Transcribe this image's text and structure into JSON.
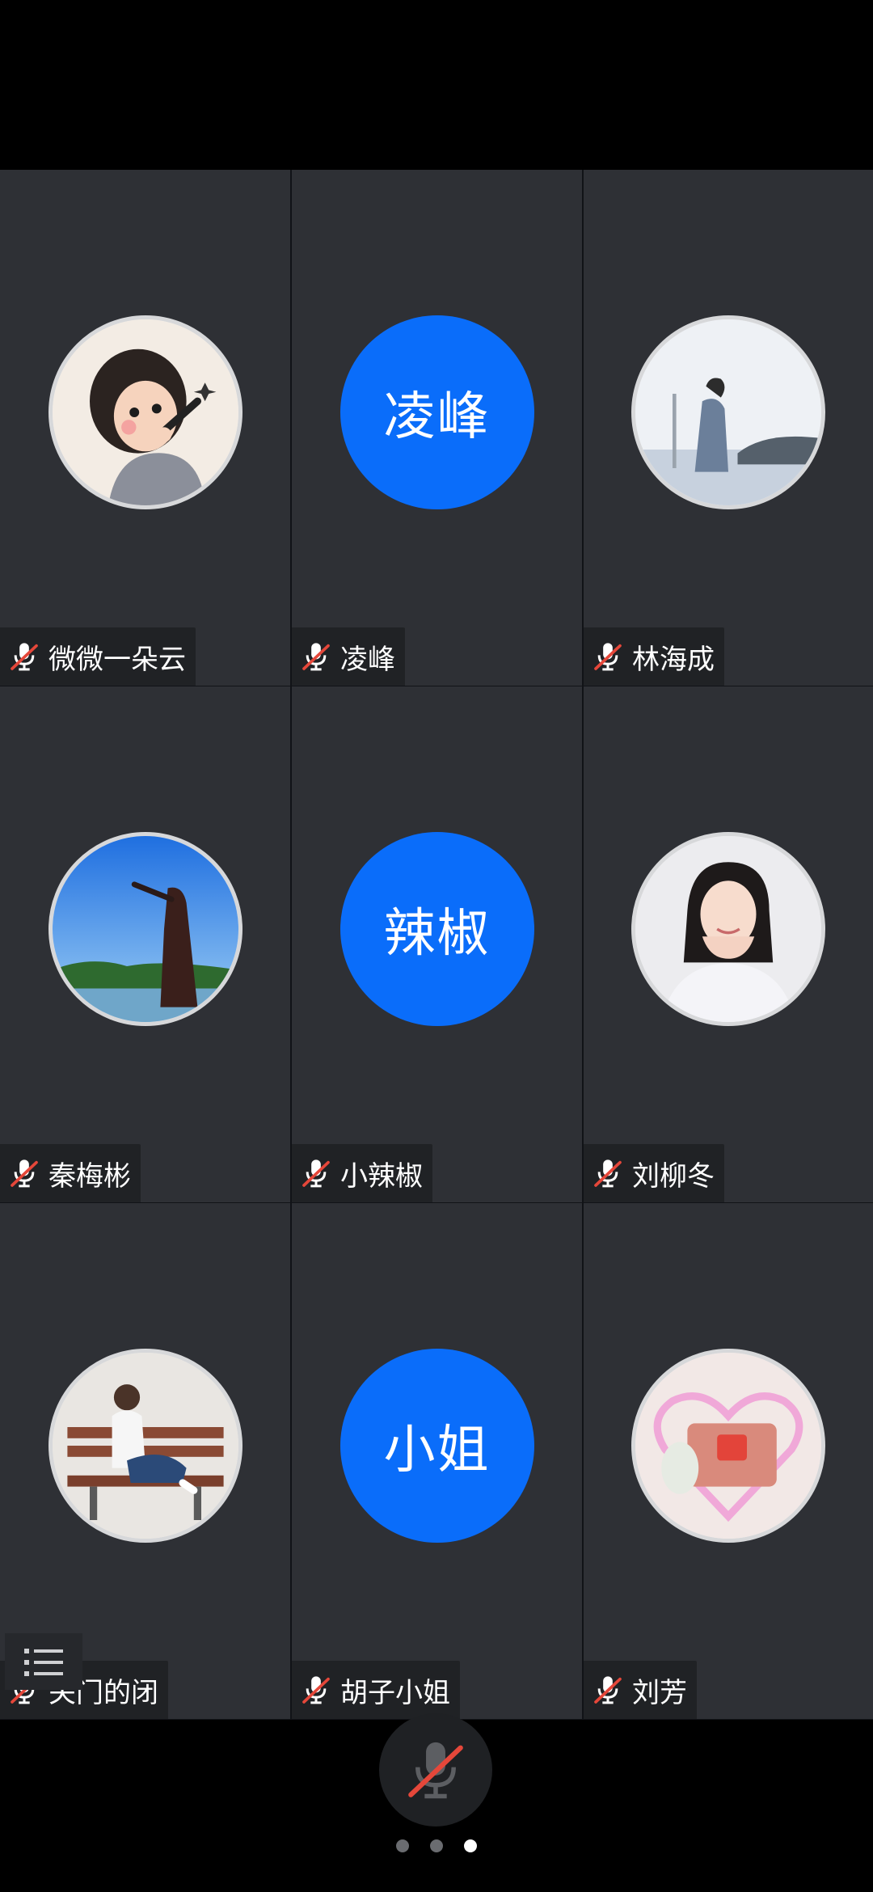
{
  "participants": [
    {
      "name": "微微一朵云",
      "avatar_text": "",
      "avatar_icon": "cartoon-singer-avatar",
      "muted": true
    },
    {
      "name": "凌峰",
      "avatar_text": "凌峰",
      "avatar_icon": "",
      "muted": true
    },
    {
      "name": "林海成",
      "avatar_text": "",
      "avatar_icon": "man-by-river-photo-avatar",
      "muted": true
    },
    {
      "name": "秦梅彬",
      "avatar_text": "",
      "avatar_icon": "woman-sky-photo-avatar",
      "muted": true
    },
    {
      "name": "小辣椒",
      "avatar_text": "辣椒",
      "avatar_icon": "",
      "muted": true
    },
    {
      "name": "刘柳冬",
      "avatar_text": "",
      "avatar_icon": "woman-portrait-photo-avatar",
      "muted": true
    },
    {
      "name": "关门的闭",
      "avatar_text": "",
      "avatar_icon": "girl-on-bench-avatar",
      "muted": true
    },
    {
      "name": "胡子小姐",
      "avatar_text": "小姐",
      "avatar_icon": "",
      "muted": true
    },
    {
      "name": "刘芳",
      "avatar_text": "",
      "avatar_icon": "heart-frame-photo-avatar",
      "muted": true
    }
  ],
  "colors": {
    "tile_bg": "#2e3035",
    "name_tag_bg": "#202225",
    "text_avatar_bg": "#0a6dfa",
    "muted_slash": "#e5473a"
  },
  "controls": {
    "mic_icon": "muted-microphone-icon",
    "list_icon": "participant-list-icon"
  },
  "pagination": {
    "total": 3,
    "current": 3
  }
}
